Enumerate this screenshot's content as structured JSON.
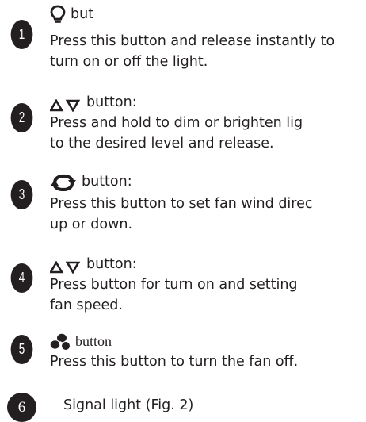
{
  "items": [
    {
      "number": "1",
      "icon": "bulb-icon",
      "title": "but",
      "lines": [
        "Press this button and release instantly to",
        "turn on or off the light."
      ]
    },
    {
      "number": "2",
      "icon": "up-down-triangle-icon",
      "title": "button:",
      "lines": [
        "Press and hold to dim or brighten lig",
        "to the desired level and release."
      ]
    },
    {
      "number": "3",
      "icon": "rotate-arrows-icon",
      "title": "button:",
      "lines": [
        "Press this button to set fan wind direc",
        "up or down."
      ]
    },
    {
      "number": "4",
      "icon": "up-down-triangle-icon",
      "title": "button:",
      "lines": [
        "Press button for turn on and setting",
        "fan speed."
      ]
    },
    {
      "number": "5",
      "icon": "fan-icon",
      "title": "button",
      "lines": [
        "Press this button to turn the fan off."
      ]
    },
    {
      "number": "6",
      "title": "Signal light (Fig. 2)"
    }
  ]
}
